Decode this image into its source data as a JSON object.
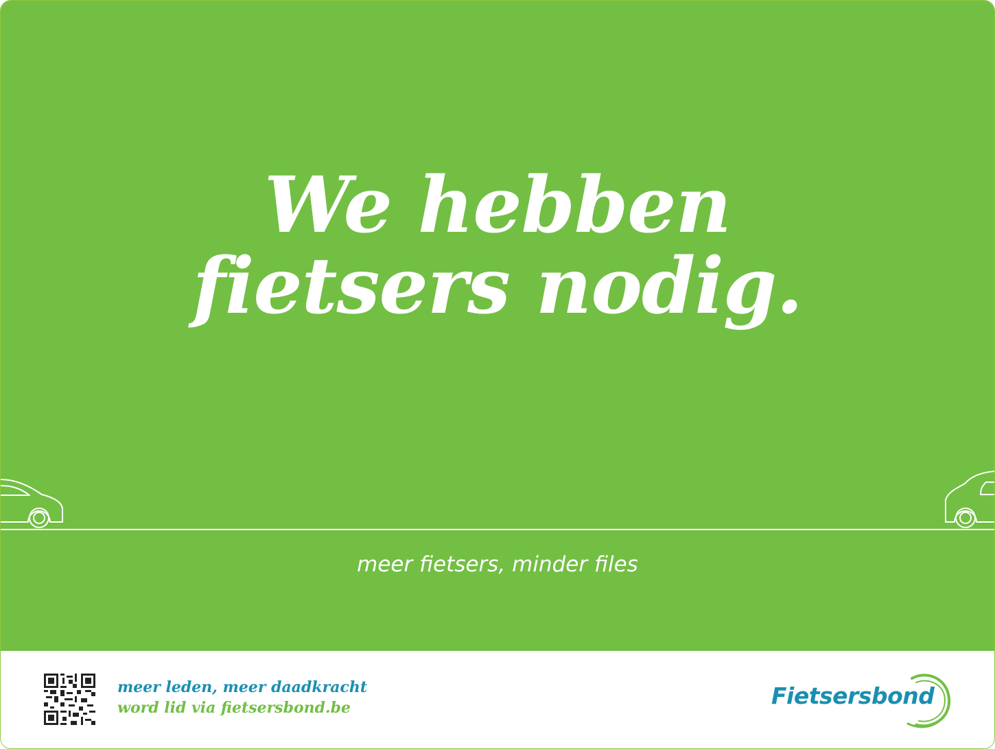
{
  "headline": {
    "line1": "We hebben",
    "line2": "fietsers nodig."
  },
  "tagline": "meer fietsers, minder files",
  "footer": {
    "line1": "meer leden, meer daadkracht",
    "line2": "word lid via fietsersbond.be"
  },
  "logo": {
    "text": "Fietsersbond"
  },
  "icons": [
    "car-left-icon",
    "car-right-icon",
    "qr-code-icon",
    "logo-swirl-icon"
  ],
  "colors": {
    "green": "#72bf44",
    "blue": "#1a8fb0",
    "white": "#ffffff"
  }
}
